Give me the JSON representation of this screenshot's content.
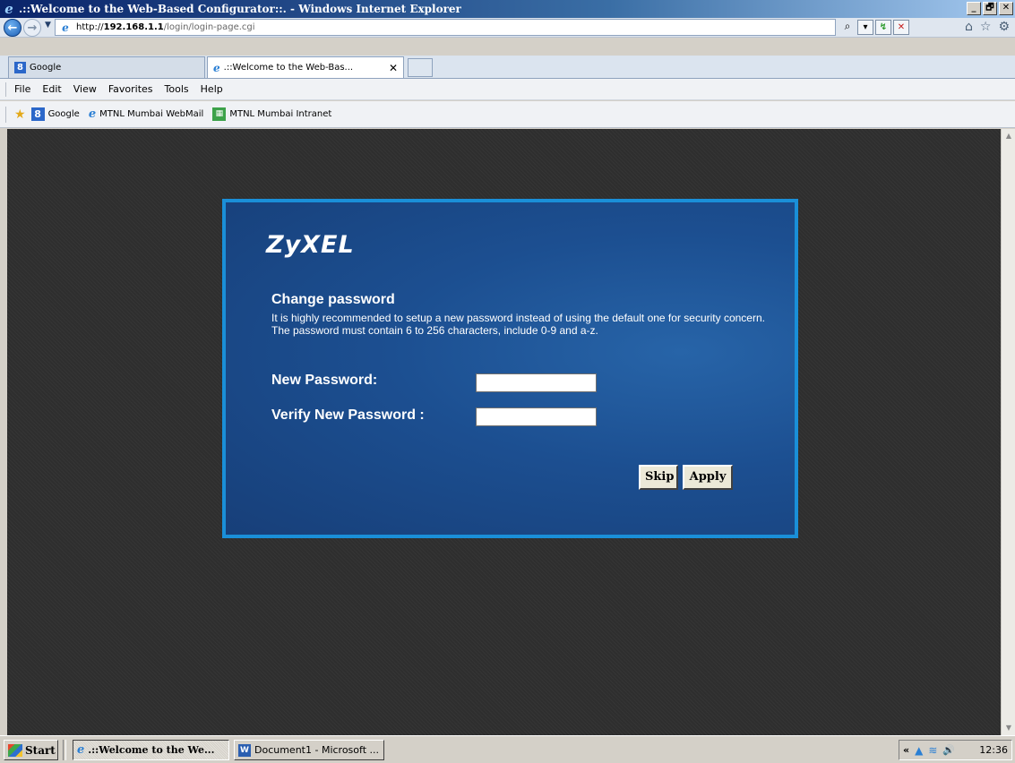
{
  "window": {
    "title": ".::Welcome to the Web-Based Configurator::. - Windows Internet Explorer",
    "controls": {
      "minimize": "_",
      "maximize": "🗗",
      "close": "✕"
    }
  },
  "address": {
    "url_prefix": "http://",
    "url_host": "192.168.1.1",
    "url_path": "/login/login-page.cgi"
  },
  "tabs": [
    {
      "label": "Google",
      "icon": "google-icon"
    },
    {
      "label": ".::Welcome to the Web-Bas...",
      "icon": "ie-page-icon",
      "close": "✕"
    }
  ],
  "menu": [
    "File",
    "Edit",
    "View",
    "Favorites",
    "Tools",
    "Help"
  ],
  "favorites": [
    {
      "label": "Google"
    },
    {
      "label": "MTNL Mumbai WebMail"
    },
    {
      "label": "MTNL Mumbai Intranet"
    }
  ],
  "login": {
    "brand": "ZyXEL",
    "heading": "Change password",
    "description": "It is highly recommended to setup a new password instead of using the default one for security concern. The password must contain 6 to 256 characters, include 0-9 and a-z.",
    "new_password_label": "New Password:",
    "verify_password_label": "Verify New Password :",
    "new_password_value": "",
    "verify_password_value": "",
    "skip_label": "Skip",
    "apply_label": "Apply"
  },
  "taskbar": {
    "start_label": "Start",
    "items": [
      {
        "label": ".::Welcome to the We..."
      },
      {
        "label": "Document1 - Microsoft ..."
      }
    ],
    "tray_chevron": "«",
    "clock": "12:36"
  },
  "colors": {
    "panel_border": "#1a8fd8",
    "panel_bg": "#1c4f91",
    "page_bg": "#2e2e2e"
  }
}
